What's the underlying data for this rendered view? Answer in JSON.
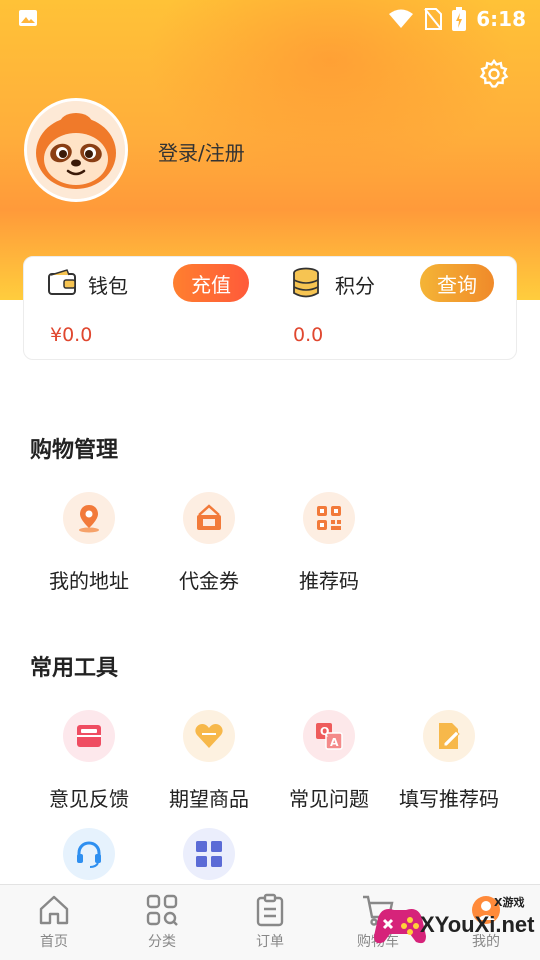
{
  "status_bar": {
    "time": "6:18"
  },
  "profile": {
    "login_text": "登录/注册"
  },
  "wallet": {
    "label": "钱包",
    "button": "充值",
    "value": "¥0.0"
  },
  "points": {
    "label": "积分",
    "button": "查询",
    "value": "0.0"
  },
  "shopping": {
    "title": "购物管理",
    "items": [
      {
        "label": "我的地址",
        "icon": "location-icon"
      },
      {
        "label": "代金券",
        "icon": "voucher-icon"
      },
      {
        "label": "推荐码",
        "icon": "qr-code-icon"
      }
    ]
  },
  "tools": {
    "title": "常用工具",
    "items": [
      {
        "label": "意见反馈",
        "icon": "feedback-icon"
      },
      {
        "label": "期望商品",
        "icon": "heart-icon"
      },
      {
        "label": "常见问题",
        "icon": "qa-icon"
      },
      {
        "label": "填写推荐码",
        "icon": "edit-code-icon"
      },
      {
        "label": "",
        "icon": "headset-icon"
      },
      {
        "label": "",
        "icon": "grid-apps-icon"
      }
    ]
  },
  "tabs": [
    {
      "label": "首页",
      "icon": "home-icon"
    },
    {
      "label": "分类",
      "icon": "category-icon"
    },
    {
      "label": "订单",
      "icon": "order-icon"
    },
    {
      "label": "购物车",
      "icon": "cart-icon"
    },
    {
      "label": "我的",
      "icon": "profile-icon"
    }
  ],
  "watermark": {
    "text": "XYouXi.net",
    "small": "X游戏"
  },
  "colors": {
    "accent": "#ff7a2e",
    "price": "#e0472f",
    "header_top": "#ffc237"
  }
}
